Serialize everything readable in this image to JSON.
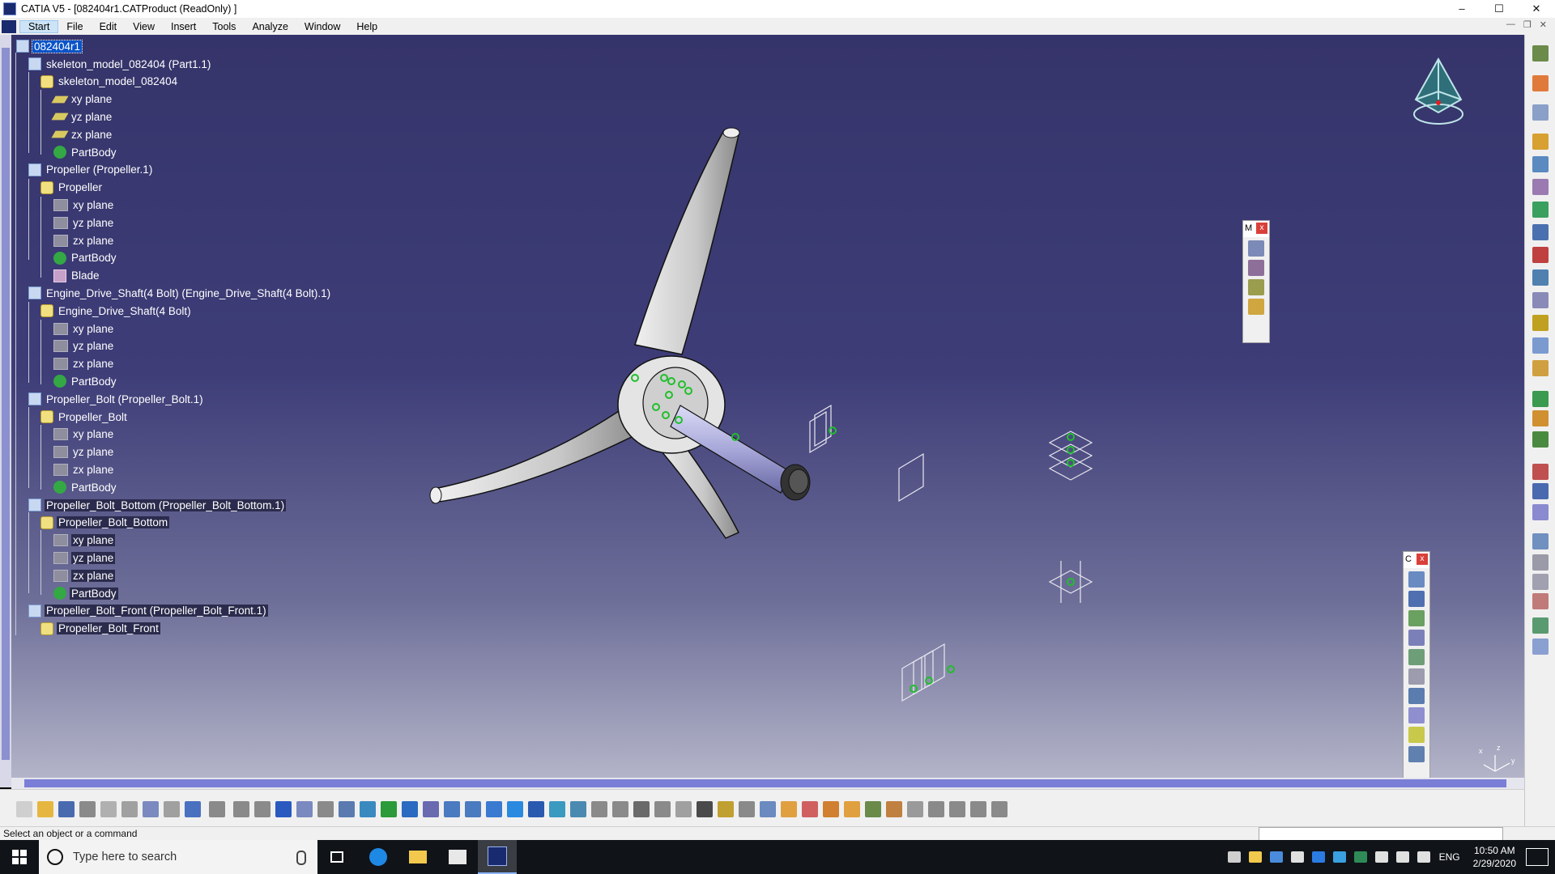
{
  "window": {
    "title": "CATIA V5 - [082404r1.CATProduct (ReadOnly) ]",
    "controls": [
      "–",
      "☐",
      "✕"
    ]
  },
  "menu": {
    "items": [
      "Start",
      "File",
      "Edit",
      "View",
      "Insert",
      "Tools",
      "Analyze",
      "Window",
      "Help"
    ]
  },
  "tree": {
    "root": "082404r1",
    "nodes": [
      {
        "label": "skeleton_model_082404 (Part1.1)",
        "icon": "part-instance"
      },
      {
        "label": "skeleton_model_082404",
        "icon": "part"
      },
      {
        "label": "xy plane",
        "icon": "plane"
      },
      {
        "label": "yz plane",
        "icon": "plane"
      },
      {
        "label": "zx plane",
        "icon": "plane"
      },
      {
        "label": "PartBody",
        "icon": "body"
      },
      {
        "label": "Propeller (Propeller.1)",
        "icon": "part-instance"
      },
      {
        "label": "Propeller",
        "icon": "part"
      },
      {
        "label": "xy plane",
        "icon": "plane-hidden"
      },
      {
        "label": "yz plane",
        "icon": "plane-hidden"
      },
      {
        "label": "zx plane",
        "icon": "plane-hidden"
      },
      {
        "label": "PartBody",
        "icon": "body"
      },
      {
        "label": "Blade",
        "icon": "sketch"
      },
      {
        "label": "Engine_Drive_Shaft(4 Bolt) (Engine_Drive_Shaft(4 Bolt).1)",
        "icon": "part-instance"
      },
      {
        "label": "Engine_Drive_Shaft(4 Bolt)",
        "icon": "part"
      },
      {
        "label": "xy plane",
        "icon": "plane-hidden"
      },
      {
        "label": "yz plane",
        "icon": "plane-hidden"
      },
      {
        "label": "zx plane",
        "icon": "plane-hidden"
      },
      {
        "label": "PartBody",
        "icon": "body"
      },
      {
        "label": "Propeller_Bolt (Propeller_Bolt.1)",
        "icon": "part-instance"
      },
      {
        "label": "Propeller_Bolt",
        "icon": "part"
      },
      {
        "label": "xy plane",
        "icon": "plane-hidden"
      },
      {
        "label": "yz plane",
        "icon": "plane-hidden"
      },
      {
        "label": "zx plane",
        "icon": "plane-hidden"
      },
      {
        "label": "PartBody",
        "icon": "body"
      },
      {
        "label": "Propeller_Bolt_Bottom (Propeller_Bolt_Bottom.1)",
        "icon": "part-instance"
      },
      {
        "label": "Propeller_Bolt_Bottom",
        "icon": "part"
      },
      {
        "label": "xy plane",
        "icon": "plane-hidden"
      },
      {
        "label": "yz plane",
        "icon": "plane-hidden"
      },
      {
        "label": "zx plane",
        "icon": "plane-hidden"
      },
      {
        "label": "PartBody",
        "icon": "body"
      },
      {
        "label": "Propeller_Bolt_Front (Propeller_Bolt_Front.1)",
        "icon": "part-instance"
      },
      {
        "label": "Propeller_Bolt_Front",
        "icon": "part"
      }
    ]
  },
  "floating_toolbars": [
    {
      "title": "M",
      "close": "x"
    },
    {
      "title": "C",
      "close": "x"
    }
  ],
  "axis_labels": {
    "x": "x",
    "y": "y",
    "z": "z"
  },
  "status": {
    "message": "Select an object or a command"
  },
  "taskbar": {
    "search_placeholder": "Type here to search",
    "language": "ENG",
    "time": "10:50 AM",
    "date": "2/29/2020"
  },
  "colors": {
    "viewport_top": "#35346a",
    "viewport_bottom": "#b7b8cb",
    "selection": "#0a54c8",
    "accent": "#8bb4ff"
  }
}
